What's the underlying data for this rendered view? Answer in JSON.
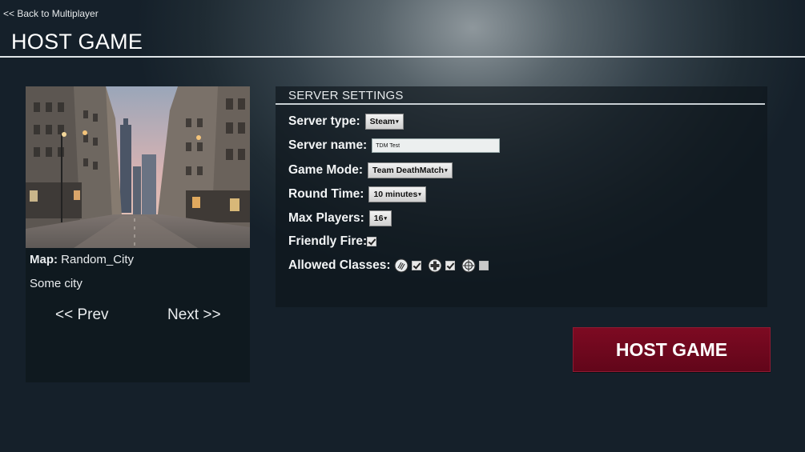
{
  "nav": {
    "back_label": "<< Back to Multiplayer"
  },
  "page": {
    "title": "HOST GAME"
  },
  "map": {
    "label": "Map:",
    "name": "Random_City",
    "description": "Some city",
    "prev_label": "<< Prev",
    "next_label": "Next >>"
  },
  "settings": {
    "header": "SERVER SETTINGS",
    "server_type": {
      "label": "Server type:",
      "value": "Steam"
    },
    "server_name": {
      "label": "Server name:",
      "value": "TDM Test"
    },
    "game_mode": {
      "label": "Game Mode:",
      "value": "Team DeathMatch"
    },
    "round_time": {
      "label": "Round Time:",
      "value": "10 minutes"
    },
    "max_players": {
      "label": "Max Players:",
      "value": "16"
    },
    "friendly_fire": {
      "label": "Friendly Fire:",
      "checked": true
    },
    "allowed_classes": {
      "label": "Allowed Classes:",
      "classes": [
        {
          "icon": "assault-class-icon",
          "checked": true
        },
        {
          "icon": "medic-class-icon",
          "checked": true
        },
        {
          "icon": "sniper-class-icon",
          "checked": false
        }
      ]
    }
  },
  "actions": {
    "host_label": "HOST GAME"
  },
  "colors": {
    "host_button": "#6e0a1f",
    "panel": "#0e161c"
  }
}
